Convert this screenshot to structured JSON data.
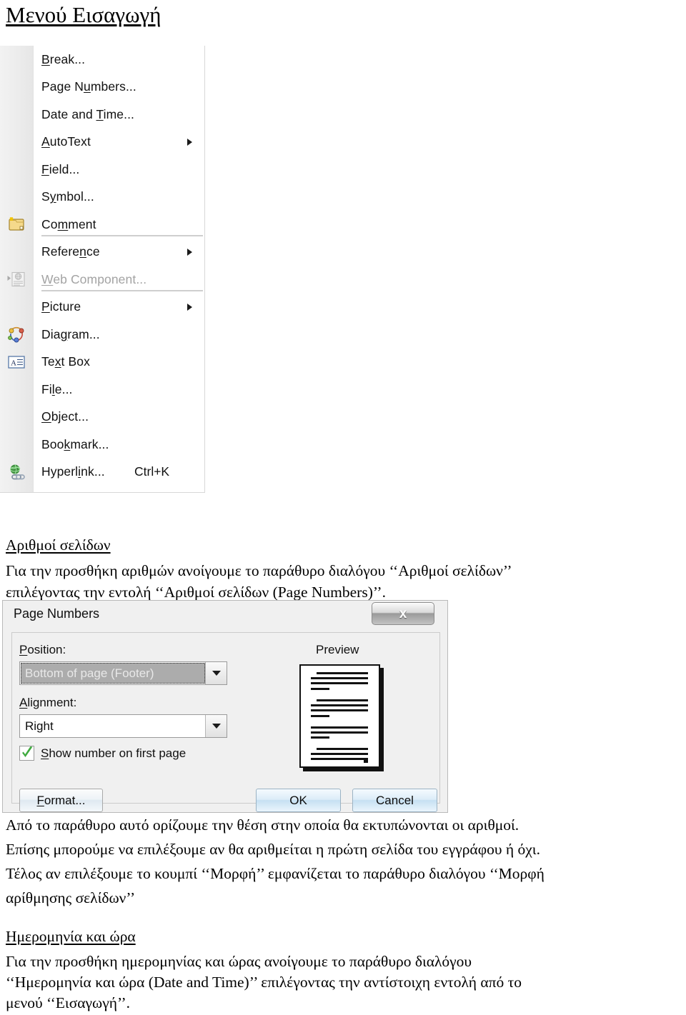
{
  "page": {
    "title": "Μενού Εισαγωγή"
  },
  "insert_menu": {
    "name": "Insert menu",
    "items": [
      {
        "label": "Break...",
        "accel": "B",
        "icon": "none",
        "arrow": false,
        "disabled": false,
        "shortcut": "",
        "separator_after": false
      },
      {
        "label": "Page Numbers...",
        "accel": "u",
        "icon": "none",
        "arrow": false,
        "disabled": false,
        "shortcut": "",
        "separator_after": false
      },
      {
        "label": "Date and Time...",
        "accel": "T",
        "icon": "none",
        "arrow": false,
        "disabled": false,
        "shortcut": "",
        "separator_after": false
      },
      {
        "label": "AutoText",
        "accel": "A",
        "icon": "none",
        "arrow": true,
        "disabled": false,
        "shortcut": "",
        "separator_after": false
      },
      {
        "label": "Field...",
        "accel": "F",
        "icon": "none",
        "arrow": false,
        "disabled": false,
        "shortcut": "",
        "separator_after": false
      },
      {
        "label": "Symbol...",
        "accel": "y",
        "icon": "none",
        "arrow": false,
        "disabled": false,
        "shortcut": "",
        "separator_after": false
      },
      {
        "label": "Comment",
        "accel": "m",
        "icon": "comment-icon",
        "arrow": false,
        "disabled": false,
        "shortcut": "",
        "separator_after": true
      },
      {
        "label": "Reference",
        "accel": "n",
        "icon": "none",
        "arrow": true,
        "disabled": false,
        "shortcut": "",
        "separator_after": false
      },
      {
        "label": "Web Component...",
        "accel": "W",
        "icon": "web-component-icon",
        "arrow": false,
        "disabled": true,
        "shortcut": "",
        "separator_after": true
      },
      {
        "label": "Picture",
        "accel": "P",
        "icon": "none",
        "arrow": true,
        "disabled": false,
        "shortcut": "",
        "separator_after": false
      },
      {
        "label": "Diagram...",
        "accel": "g",
        "icon": "diagram-icon",
        "arrow": false,
        "disabled": false,
        "shortcut": "",
        "separator_after": false
      },
      {
        "label": "Text Box",
        "accel": "x",
        "icon": "text-box-icon",
        "arrow": false,
        "disabled": false,
        "shortcut": "",
        "separator_after": false
      },
      {
        "label": "File...",
        "accel": "l",
        "icon": "none",
        "arrow": false,
        "disabled": false,
        "shortcut": "",
        "separator_after": false
      },
      {
        "label": "Object...",
        "accel": "O",
        "icon": "none",
        "arrow": false,
        "disabled": false,
        "shortcut": "",
        "separator_after": false
      },
      {
        "label": "Bookmark...",
        "accel": "k",
        "icon": "none",
        "arrow": false,
        "disabled": false,
        "shortcut": "",
        "separator_after": false
      },
      {
        "label": "Hyperlink...",
        "accel": "i",
        "icon": "hyperlink-icon",
        "arrow": false,
        "disabled": false,
        "shortcut": "Ctrl+K",
        "separator_after": false
      }
    ]
  },
  "section_page_numbers": {
    "heading": "Αριθμοί σελίδων",
    "intro_line1": "Για την προσθήκη αριθμών ανοίγουμε το παράθυρο διαλόγου ‘‘Αριθμοί σελίδων’’",
    "intro_line2": "επιλέγοντας την εντολή ‘‘Αριθμοί σελίδων (Page Numbers)’’.",
    "after_line1": "Από το παράθυρο αυτό ορίζουμε την θέση στην οποία θα εκτυπώνονται οι αριθμοί.",
    "after_line2": "Επίσης μπορούμε να επιλέξουμε αν θα αριθμείται η πρώτη σελίδα του εγγράφου ή όχι.",
    "after_line3": "Τέλος αν επιλέξουμε το κουμπί ‘‘Μορφή’’ εμφανίζεται το παράθυρο διαλόγου ‘‘Μορφή",
    "after_line4": "αρίθμησης σελίδων’’"
  },
  "dialog": {
    "title": "Page Numbers",
    "close_label": "x",
    "position_label": "Position:",
    "position_accel": "P",
    "position_value": "Bottom of page (Footer)",
    "alignment_label": "Alignment:",
    "alignment_accel": "A",
    "alignment_value": "Right",
    "checkbox_label": "Show number on first page",
    "checkbox_accel": "S",
    "checkbox_checked": true,
    "preview_label": "Preview",
    "format_button": "Format...",
    "format_accel": "F",
    "ok_button": "OK",
    "cancel_button": "Cancel"
  },
  "section_date_time": {
    "heading": "Ημερομηνία και ώρα",
    "line1": "Για την προσθήκη ημερομηνίας και ώρας ανοίγουμε το παράθυρο διαλόγου",
    "line2": "‘‘Ημερομηνία και ώρα (Date and Time)’’ επιλέγοντας την αντίστοιχη εντολή από το",
    "line3": "μενού ‘‘Εισαγωγή’’."
  },
  "colors": {
    "menu_background": "#ffffff",
    "menu_gutter": "#ececec",
    "dialog_face": "#f0f0f0",
    "button_blue": "#c6e0f2",
    "check_green": "#3faa3f",
    "text": "#000000",
    "disabled_text": "#a3a3a3"
  }
}
